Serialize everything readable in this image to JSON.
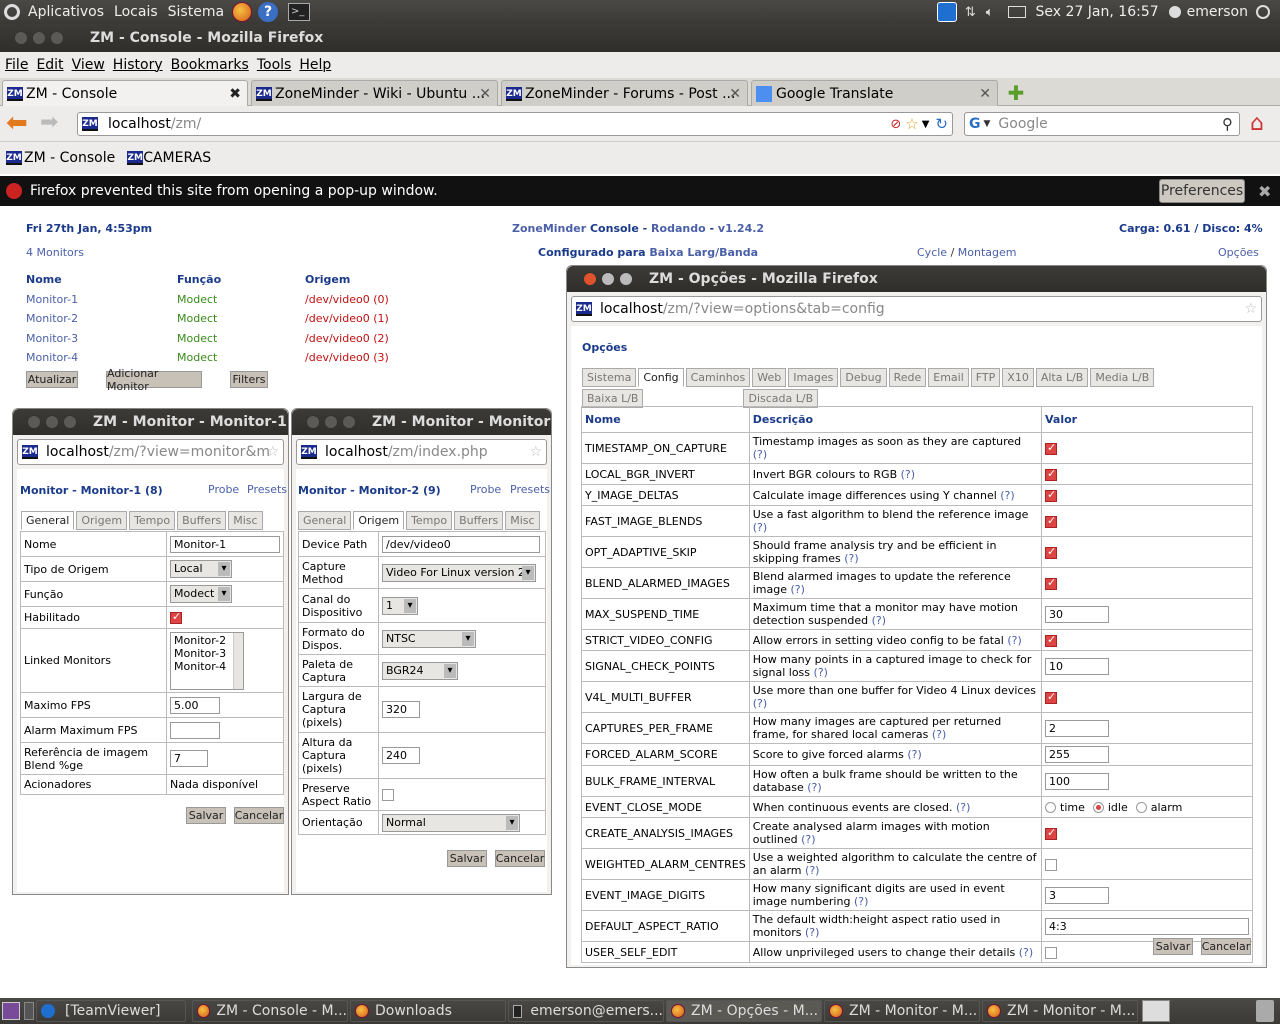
{
  "panel": {
    "apps": "Aplicativos",
    "places": "Locais",
    "system": "Sistema",
    "datetime": "Sex 27 Jan, 16:57",
    "user": "emerson"
  },
  "firefox": {
    "title": "ZM - Console - Mozilla Firefox",
    "menu": [
      "File",
      "Edit",
      "View",
      "History",
      "Bookmarks",
      "Tools",
      "Help"
    ],
    "tabs": [
      "ZM - Console",
      "ZoneMinder - Wiki - Ubuntu ...",
      "ZoneMinder - Forums - Post ...",
      "Google Translate"
    ],
    "url_host": "localhost",
    "url_path": "/zm/",
    "search_placeholder": "Google",
    "bookmarks": [
      "ZM - Console",
      "CAMERAS"
    ],
    "popup_msg": "Firefox prevented this site from opening a pop-up window.",
    "popup_btn": "Preferences"
  },
  "console": {
    "date": "Fri 27th Jan, 4:53pm",
    "zm": "ZoneMinder",
    "console": "Console",
    "sep": "-",
    "state": "Rodando",
    "version": "v1.24.2",
    "load": "Carga: 0.61 / Disco: 4%",
    "monitors_count": "4 Monitors",
    "configured_for": "Configurado para",
    "bandwidth": "Baixa Larg/Banda",
    "cycle": "Cycle",
    "slash": "/",
    "montage": "Montagem",
    "options": "Opções",
    "headers": [
      "Nome",
      "Função",
      "Origem"
    ],
    "monitors": [
      {
        "name": "Monitor-1",
        "func": "Modect",
        "src": "/dev/video0 (0)"
      },
      {
        "name": "Monitor-2",
        "func": "Modect",
        "src": "/dev/video0 (1)"
      },
      {
        "name": "Monitor-3",
        "func": "Modect",
        "src": "/dev/video0 (2)"
      },
      {
        "name": "Monitor-4",
        "func": "Modect",
        "src": "/dev/video0 (3)"
      }
    ],
    "buttons": [
      "Atualizar",
      "Adicionar Monitor",
      "Filters"
    ]
  },
  "mon1": {
    "wtitle": "ZM - Monitor - Monitor-1",
    "url_host": "localhost",
    "url_path": "/zm/?view=monitor&m",
    "heading": "Monitor - Monitor-1 (8)",
    "probe": "Probe",
    "presets": "Presets",
    "tabs": [
      "General",
      "Origem",
      "Tempo",
      "Buffers",
      "Misc"
    ],
    "rows": {
      "nome": "Nome",
      "nome_val": "Monitor-1",
      "tipo": "Tipo de Origem",
      "tipo_val": "Local",
      "func": "Função",
      "func_val": "Modect",
      "hab": "Habilitado",
      "linked": "Linked Monitors",
      "linked_vals": [
        "Monitor-2",
        "Monitor-3",
        "Monitor-4"
      ],
      "maxfps": "Maximo FPS",
      "maxfps_val": "5.00",
      "alarmfps": "Alarm Maximum FPS",
      "ref": "Referência de imagem Blend %ge",
      "ref_val": "7",
      "acion": "Acionadores",
      "acion_val": "Nada disponível"
    },
    "save": "Salvar",
    "cancel": "Cancelar"
  },
  "mon2": {
    "wtitle": "ZM - Monitor - Monitor",
    "url_host": "localhost",
    "url_path": "/zm/index.php",
    "heading": "Monitor - Monitor-2 (9)",
    "probe": "Probe",
    "presets": "Presets",
    "tabs": [
      "General",
      "Origem",
      "Tempo",
      "Buffers",
      "Misc"
    ],
    "rows": {
      "dev": "Device Path",
      "dev_val": "/dev/video0",
      "cap": "Capture Method",
      "cap_val": "Video For Linux version 2",
      "canal": "Canal do Dispositivo",
      "canal_val": "1",
      "fmt": "Formato do Dispos.",
      "fmt_val": "NTSC",
      "pal": "Paleta de Captura",
      "pal_val": "BGR24",
      "larg": "Largura de Captura (pixels)",
      "larg_val": "320",
      "alt": "Altura da Captura (pixels)",
      "alt_val": "240",
      "pres": "Preserve Aspect Ratio",
      "ori": "Orientação",
      "ori_val": "Normal"
    },
    "save": "Salvar",
    "cancel": "Cancelar"
  },
  "opts": {
    "wtitle": "ZM - Opções - Mozilla Firefox",
    "url_host": "localhost",
    "url_path": "/zm/?view=options&tab=config",
    "heading": "Opções",
    "tabs": [
      "Sistema",
      "Config",
      "Caminhos",
      "Web",
      "Images",
      "Debug",
      "Rede",
      "Email",
      "FTP",
      "X10",
      "Alta L/B",
      "Media L/B",
      "Baixa L/B",
      "Discada L/B"
    ],
    "headers": [
      "Nome",
      "Descrição",
      "Valor"
    ],
    "rows": [
      {
        "n": "TIMESTAMP_ON_CAPTURE",
        "d": "Timestamp images as soon as they are captured",
        "t": "chk",
        "v": "1"
      },
      {
        "n": "LOCAL_BGR_INVERT",
        "d": "Invert BGR colours to RGB",
        "t": "chk",
        "v": "1"
      },
      {
        "n": "Y_IMAGE_DELTAS",
        "d": "Calculate image differences using Y channel",
        "t": "chk",
        "v": "1"
      },
      {
        "n": "FAST_IMAGE_BLENDS",
        "d": "Use a fast algorithm to blend the reference image",
        "t": "chk",
        "v": "1"
      },
      {
        "n": "OPT_ADAPTIVE_SKIP",
        "d": "Should frame analysis try and be efficient in skipping frames",
        "t": "chk",
        "v": "1"
      },
      {
        "n": "BLEND_ALARMED_IMAGES",
        "d": "Blend alarmed images to update the reference image",
        "t": "chk",
        "v": "1"
      },
      {
        "n": "MAX_SUSPEND_TIME",
        "d": "Maximum time that a monitor may have motion detection suspended",
        "t": "txt",
        "v": "30"
      },
      {
        "n": "STRICT_VIDEO_CONFIG",
        "d": "Allow errors in setting video config to be fatal",
        "t": "chk",
        "v": "1"
      },
      {
        "n": "SIGNAL_CHECK_POINTS",
        "d": "How many points in a captured image to check for signal loss",
        "t": "txt",
        "v": "10"
      },
      {
        "n": "V4L_MULTI_BUFFER",
        "d": "Use more than one buffer for Video 4 Linux devices",
        "t": "chk",
        "v": "1"
      },
      {
        "n": "CAPTURES_PER_FRAME",
        "d": "How many images are captured per returned frame, for shared local cameras",
        "t": "txt",
        "v": "2"
      },
      {
        "n": "FORCED_ALARM_SCORE",
        "d": "Score to give forced alarms",
        "t": "txt",
        "v": "255"
      },
      {
        "n": "BULK_FRAME_INTERVAL",
        "d": "How often a bulk frame should be written to the database",
        "t": "txt",
        "v": "100"
      },
      {
        "n": "EVENT_CLOSE_MODE",
        "d": "When continuous events are closed.",
        "t": "radio",
        "v": "idle",
        "opts": [
          "time",
          "idle",
          "alarm"
        ]
      },
      {
        "n": "CREATE_ANALYSIS_IMAGES",
        "d": "Create analysed alarm images with motion outlined",
        "t": "chk",
        "v": "1"
      },
      {
        "n": "WEIGHTED_ALARM_CENTRES",
        "d": "Use a weighted algorithm to calculate the centre of an alarm",
        "t": "chk",
        "v": "0"
      },
      {
        "n": "EVENT_IMAGE_DIGITS",
        "d": "How many significant digits are used in event image numbering",
        "t": "txt",
        "v": "3"
      },
      {
        "n": "DEFAULT_ASPECT_RATIO",
        "d": "The default width:height aspect ratio used in monitors",
        "t": "wide",
        "v": "4:3"
      },
      {
        "n": "USER_SELF_EDIT",
        "d": "Allow unprivileged users to change their details",
        "t": "chk",
        "v": "0"
      }
    ],
    "help": "(?)",
    "save": "Salvar",
    "cancel": "Cancelar"
  },
  "taskbar": [
    "[TeamViewer]",
    "ZM - Console - M...",
    "Downloads",
    "emerson@emers...",
    "ZM - Opções - M...",
    "ZM - Monitor - M...",
    "ZM - Monitor - M..."
  ]
}
